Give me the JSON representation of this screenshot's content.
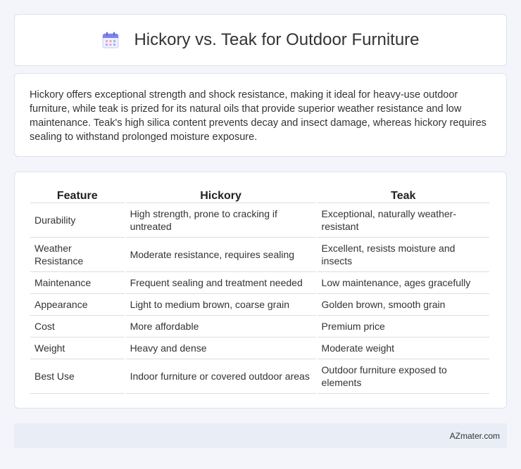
{
  "header": {
    "title": "Hickory vs. Teak for Outdoor Furniture",
    "icon": "calendar-icon"
  },
  "intro": {
    "text": "Hickory offers exceptional strength and shock resistance, making it ideal for heavy-use outdoor furniture, while teak is prized for its natural oils that provide superior weather resistance and low maintenance. Teak's high silica content prevents decay and insect damage, whereas hickory requires sealing to withstand prolonged moisture exposure."
  },
  "table": {
    "headers": [
      "Feature",
      "Hickory",
      "Teak"
    ],
    "rows": [
      [
        "Durability",
        "High strength, prone to cracking if untreated",
        "Exceptional, naturally weather-resistant"
      ],
      [
        "Weather Resistance",
        "Moderate resistance, requires sealing",
        "Excellent, resists moisture and insects"
      ],
      [
        "Maintenance",
        "Frequent sealing and treatment needed",
        "Low maintenance, ages gracefully"
      ],
      [
        "Appearance",
        "Light to medium brown, coarse grain",
        "Golden brown, smooth grain"
      ],
      [
        "Cost",
        "More affordable",
        "Premium price"
      ],
      [
        "Weight",
        "Heavy and dense",
        "Moderate weight"
      ],
      [
        "Best Use",
        "Indoor furniture or covered outdoor areas",
        "Outdoor furniture exposed to elements"
      ]
    ]
  },
  "footer": {
    "text": "AZmater.com"
  }
}
